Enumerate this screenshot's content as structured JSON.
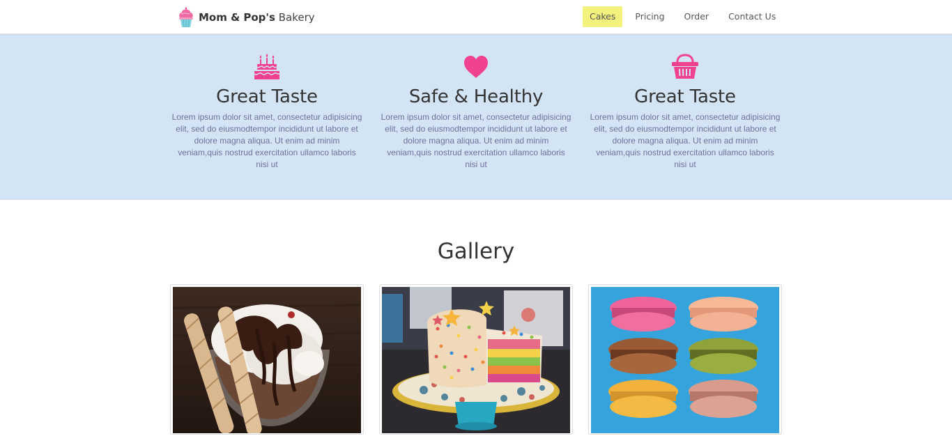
{
  "brand": {
    "strong": "Mom & Pop's",
    "light": "Bakery"
  },
  "nav": {
    "items": [
      {
        "label": "Cakes",
        "active": true
      },
      {
        "label": "Pricing",
        "active": false
      },
      {
        "label": "Order",
        "active": false
      },
      {
        "label": "Contact Us",
        "active": false
      }
    ]
  },
  "features": [
    {
      "icon": "birthday-cake-icon",
      "title": "Great Taste",
      "text": "Lorem ipsum dolor sit amet, consectetur adipisicing elit, sed do eiusmodtempor incididunt ut labore et dolore magna aliqua. Ut enim ad minim veniam,quis nostrud exercitation ullamco laboris nisi ut"
    },
    {
      "icon": "heart-icon",
      "title": "Safe & Healthy",
      "text": "Lorem ipsum dolor sit amet, consectetur adipisicing elit, sed do eiusmodtempor incididunt ut labore et dolore magna aliqua. Ut enim ad minim veniam,quis nostrud exercitation ullamco laboris nisi ut"
    },
    {
      "icon": "shopping-basket-icon",
      "title": "Great Taste",
      "text": "Lorem ipsum dolor sit amet, consectetur adipisicing elit, sed do eiusmodtempor incididunt ut labore et dolore magna aliqua. Ut enim ad minim veniam,quis nostrud exercitation ullamco laboris nisi ut"
    }
  ],
  "gallery": {
    "title": "Gallery",
    "images": [
      {
        "name": "ice-cream-sundae-image"
      },
      {
        "name": "sprinkle-cake-image"
      },
      {
        "name": "macarons-image"
      }
    ]
  },
  "colors": {
    "accent_pink": "#f0428e",
    "features_bg": "#d3e5f5",
    "nav_active_bg": "#f3f27d",
    "body_text": "#6f6f9c"
  }
}
